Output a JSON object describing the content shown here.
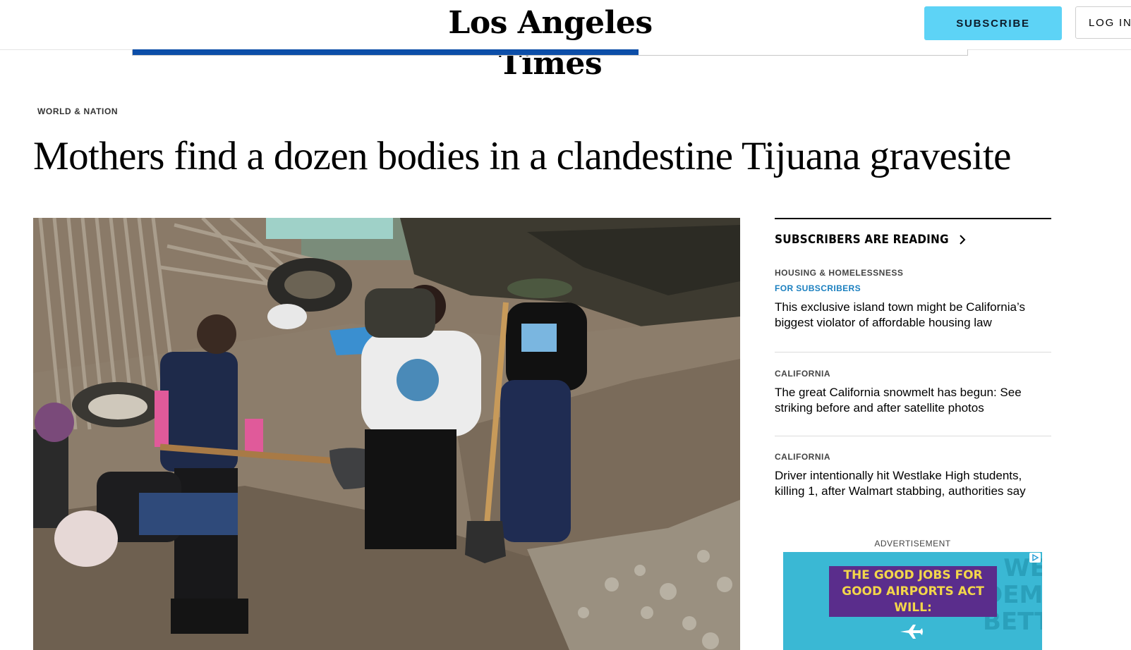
{
  "header": {
    "logo_text": "Los Angeles Times",
    "subscribe_label": "SUBSCRIBE",
    "login_label": "LOG IN"
  },
  "reading_progress": 0.606,
  "article": {
    "section": "WORLD & NATION",
    "headline": "Mothers find a dozen bodies in a clandestine Tijuana gravesite"
  },
  "sidebar": {
    "title": "SUBSCRIBERS ARE READING",
    "stories": [
      {
        "category": "HOUSING & HOMELESSNESS",
        "tag": "FOR SUBSCRIBERS",
        "title": "This exclusive island town might be California’s biggest violator of affordable housing law"
      },
      {
        "category": "CALIFORNIA",
        "title": "The great California snowmelt has begun: See striking before and after satellite photos"
      },
      {
        "category": "CALIFORNIA",
        "title": "Driver intentionally hit Westlake High students, killing 1, after Walmart stabbing, authorities say"
      }
    ]
  },
  "advertisement": {
    "label": "ADVERTISEMENT",
    "headline": "THE GOOD JOBS FOR GOOD AIRPORTS ACT WILL:",
    "background_text": "WE DEMA BETTE",
    "colors": {
      "background": "#3ab8d4",
      "box": "#5a2d8c",
      "text": "#f3d64a"
    }
  },
  "colors": {
    "subscribe_button": "#5dd3f6",
    "progress_fill": "#0c4ea8",
    "for_subscribers_tag": "#1a7fbf"
  }
}
